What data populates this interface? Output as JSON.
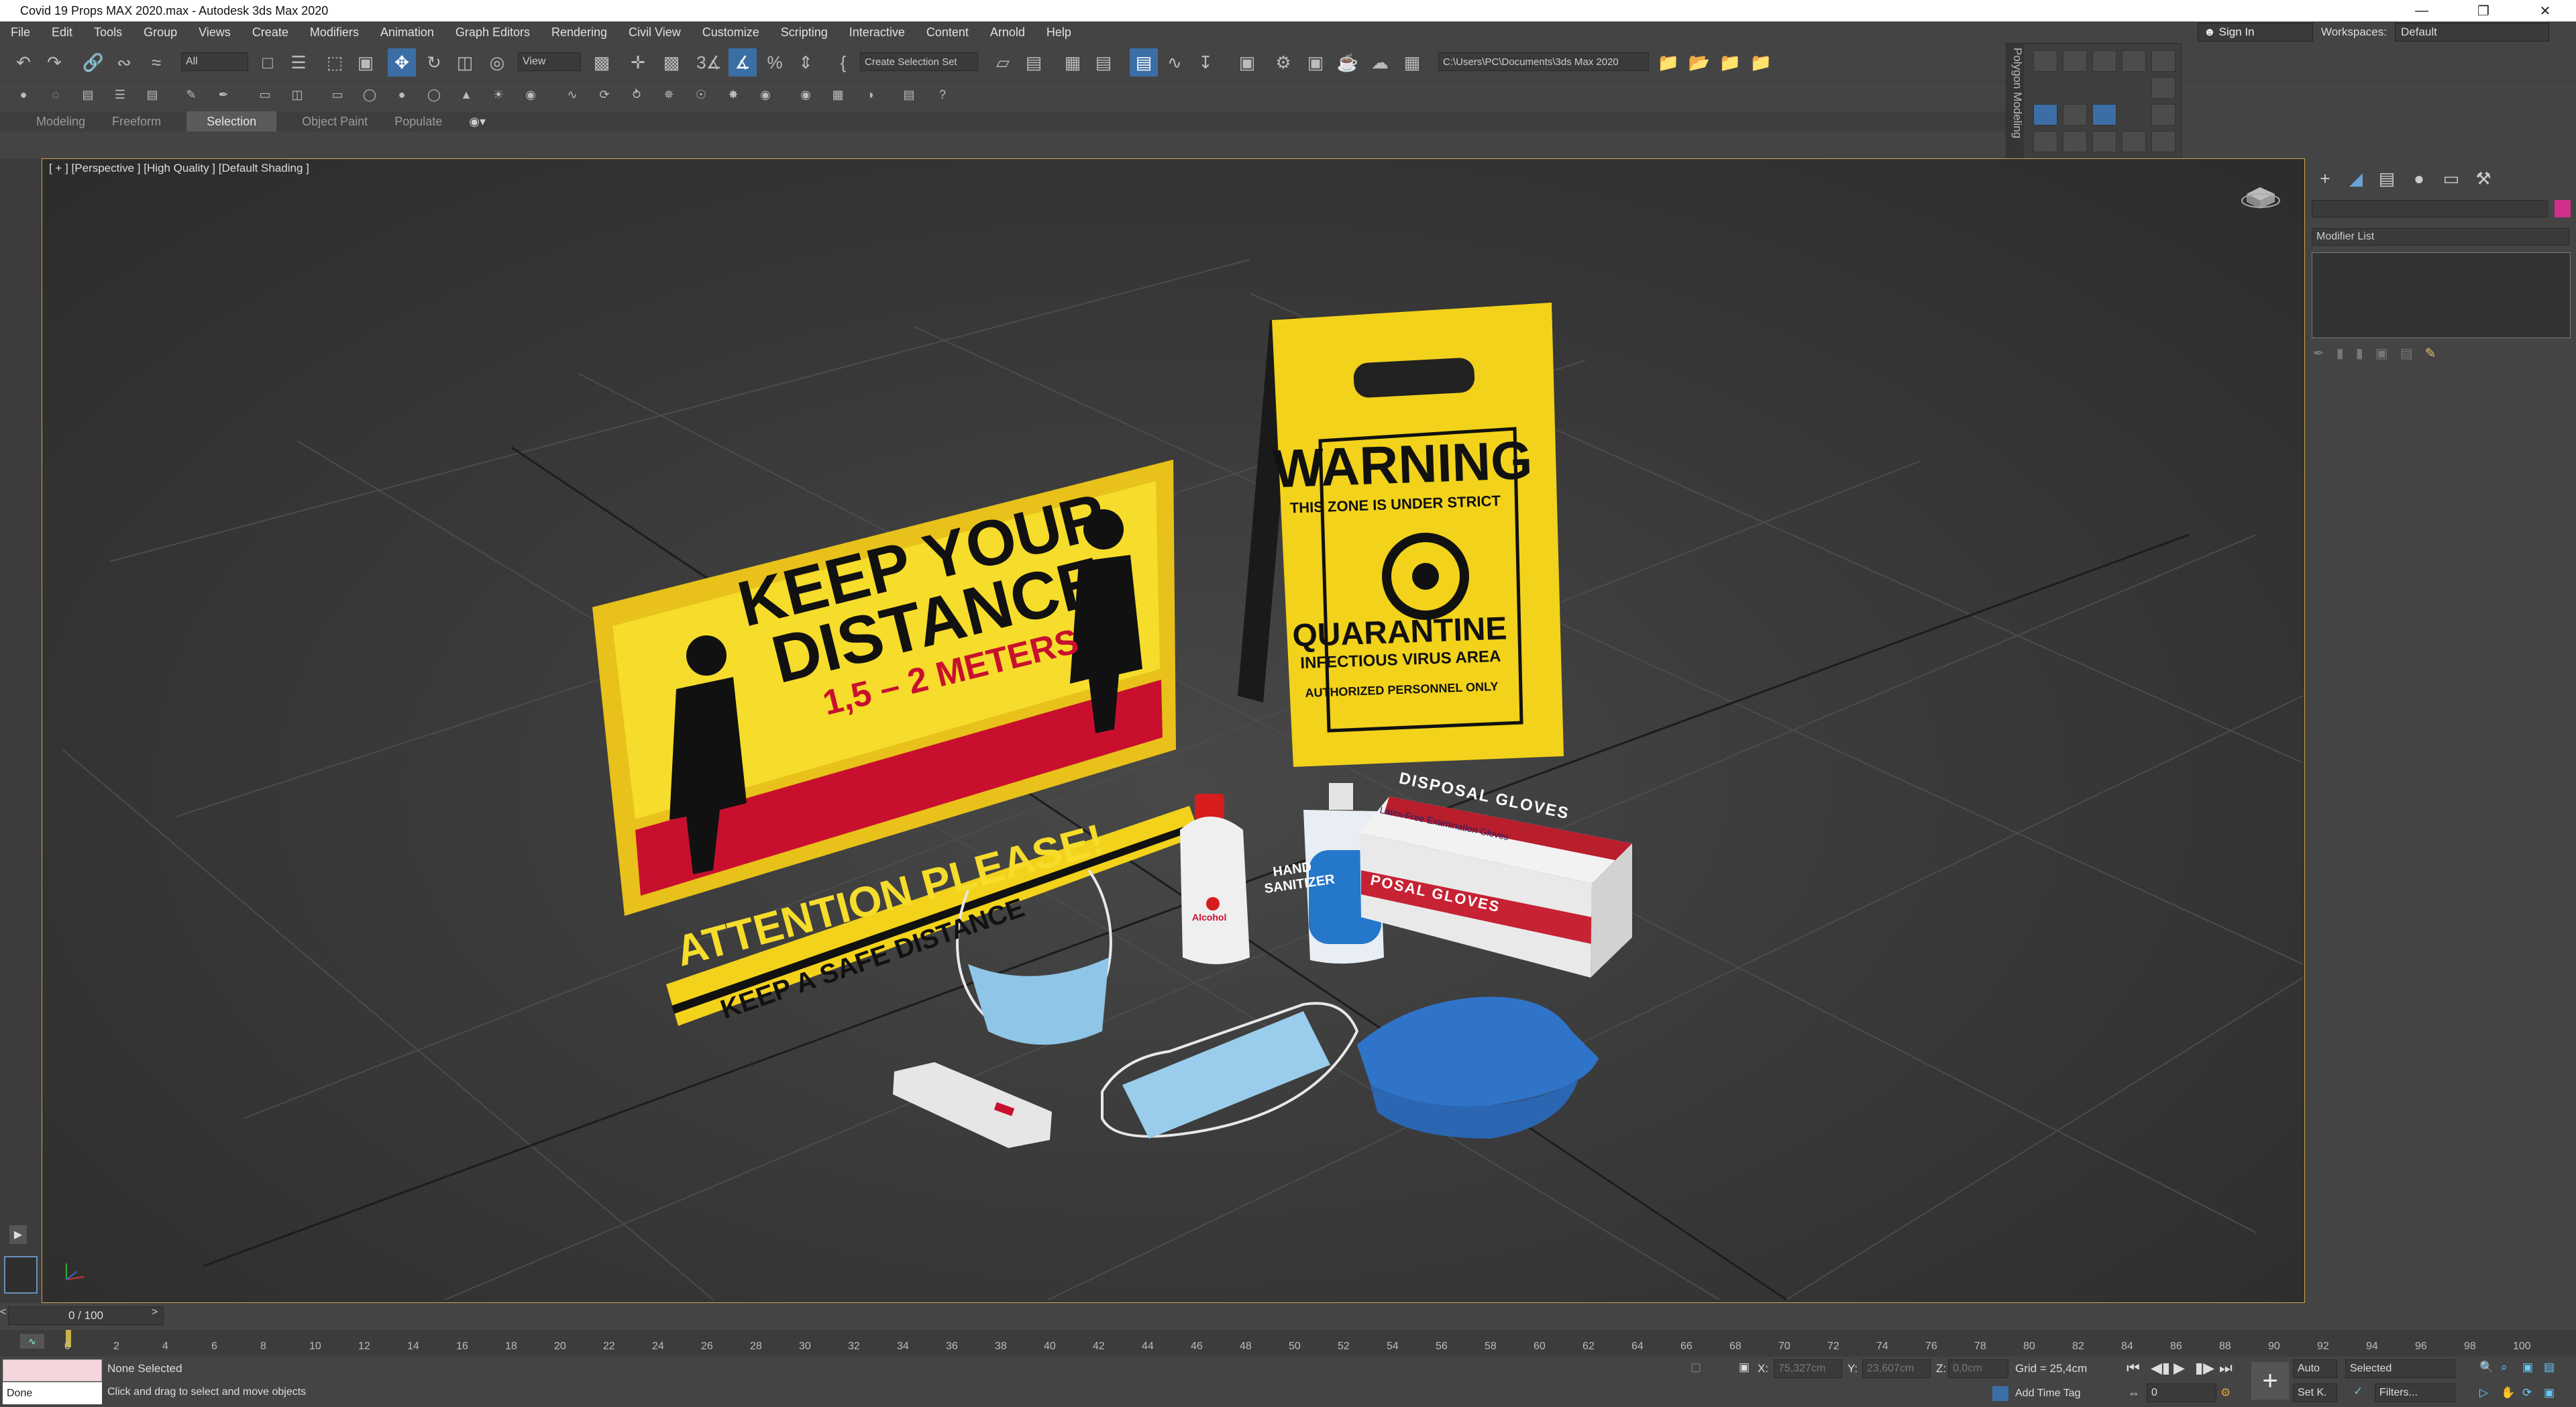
{
  "window": {
    "title": "Covid 19 Props MAX 2020.max - Autodesk 3ds Max 2020"
  },
  "menu": [
    "File",
    "Edit",
    "Tools",
    "Group",
    "Views",
    "Create",
    "Modifiers",
    "Animation",
    "Graph Editors",
    "Rendering",
    "Civil View",
    "Customize",
    "Scripting",
    "Interactive",
    "Content",
    "Arnold",
    "Help"
  ],
  "account": {
    "sign_in": "Sign In",
    "workspaces_label": "Workspaces:",
    "workspace": "Default"
  },
  "toolbar": {
    "filter": "All",
    "coord_system": "View",
    "selection_set": "Create Selection Set",
    "project_path": "C:\\Users\\PC\\Documents\\3ds Max 2020"
  },
  "ribbon": {
    "tabs": [
      "Modeling",
      "Freeform",
      "Selection",
      "Object Paint",
      "Populate"
    ],
    "active": "Selection"
  },
  "polygon_panel": {
    "label": "Polygon Modeling"
  },
  "viewport": {
    "label": "[ + ] [Perspective ] [High Quality ] [Default Shading ]",
    "props": {
      "distance_sign": {
        "line1": "KEEP YOUR",
        "line2": "DISTANCE",
        "line3": "1,5 – 2 METERS",
        "line4": "ATTENTION PLEASE!"
      },
      "warning_sign": {
        "line1": "WARNING",
        "line2": "THIS ZONE IS UNDER STRICT",
        "line3": "QUARANTINE",
        "line4": "INFECTIOUS VIRUS AREA",
        "line5": "AUTHORIZED PERSONNEL ONLY"
      },
      "floor_tape": "KEEP A SAFE DISTANCE",
      "sanitizer": {
        "line1": "HAND",
        "line2": "SANITIZER"
      },
      "alcohol_label": "Alcohol",
      "gloves_box": {
        "top": "DISPOSAL GLOVES",
        "sub": "Latex-Free Examination Gloves",
        "side": "POSAL GLOVES"
      }
    }
  },
  "command_panel": {
    "modifier_list": "Modifier List"
  },
  "timeline": {
    "slider": "0 / 100",
    "ticks": [
      "0",
      "2",
      "4",
      "6",
      "8",
      "10",
      "12",
      "14",
      "16",
      "18",
      "20",
      "22",
      "24",
      "26",
      "28",
      "30",
      "32",
      "34",
      "36",
      "38",
      "40",
      "42",
      "44",
      "46",
      "48",
      "50",
      "52",
      "54",
      "56",
      "58",
      "60",
      "62",
      "64",
      "66",
      "68",
      "70",
      "72",
      "74",
      "76",
      "78",
      "80",
      "82",
      "84",
      "86",
      "88",
      "90",
      "92",
      "94",
      "96",
      "98",
      "100"
    ]
  },
  "status": {
    "maxscript_output": "Done",
    "selection": "None Selected",
    "prompt": "Click and drag to select and move objects",
    "x_label": "X:",
    "x": "75,327cm",
    "y_label": "Y:",
    "y": "23,607cm",
    "z_label": "Z:",
    "z": "0,0cm",
    "grid": "Grid = 25,4cm",
    "add_time_tag": "Add Time Tag",
    "auto_key": "Auto",
    "key_mode": "Selected",
    "set_key": "Set K.",
    "filters": "Filters...",
    "frame": "0"
  },
  "colors": {
    "accent": "#3c6ea6",
    "sign_yellow": "#f2d21b",
    "sign_red": "#c8102e",
    "viewport_border": "#d2a34a",
    "glove_blue": "#2f74c8",
    "mask_blue": "#8fc5e6"
  }
}
